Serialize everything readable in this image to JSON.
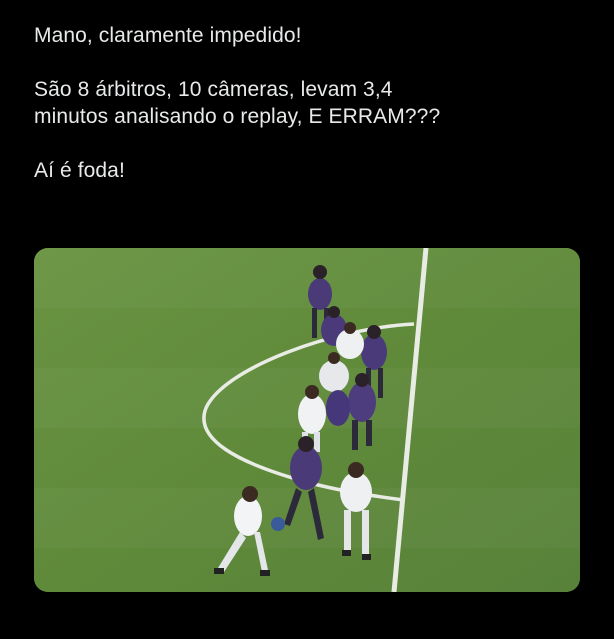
{
  "tweet": {
    "lines": [
      "Mano, claramente impedido!",
      "São 8 árbitros, 10 câmeras, levam 3,4",
      "minutos analisando o replay, E ERRAM???",
      "Aí é foda!"
    ]
  },
  "media": {
    "description_icon": "football-offside-photo",
    "colors": {
      "pitch": "#5f8a3a",
      "pitch_dark": "#557f33",
      "line": "#e8ece4",
      "team_purple": "#4b3a78",
      "team_white": "#eef0f2"
    }
  }
}
